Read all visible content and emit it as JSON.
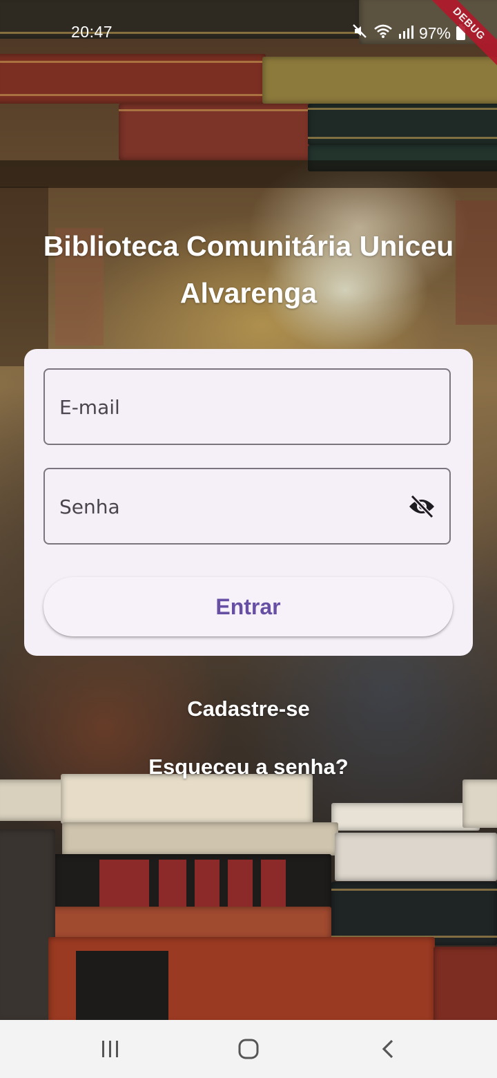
{
  "status_bar": {
    "time": "20:47",
    "battery": "97%",
    "icons": [
      "mute-icon",
      "wifi-icon",
      "signal-icon",
      "battery-icon"
    ],
    "debug_banner": "DEBUG"
  },
  "app": {
    "title": "Biblioteca Comunitária Uniceu Alvarenga"
  },
  "login_form": {
    "email_placeholder": "E-mail",
    "email_value": "",
    "password_placeholder": "Senha",
    "password_value": "",
    "password_visibility_icon": "visibility-off-icon",
    "submit_label": "Entrar"
  },
  "links": {
    "register": "Cadastre-se",
    "forgot_password": "Esqueceu a senha?"
  },
  "nav_bar": {
    "buttons": [
      "recent-apps-icon",
      "home-icon",
      "back-icon"
    ]
  },
  "colors": {
    "card_background": "#f5eff7",
    "primary": "#6750a4",
    "outline": "#79747e",
    "debug_banner": "#b2182b"
  }
}
